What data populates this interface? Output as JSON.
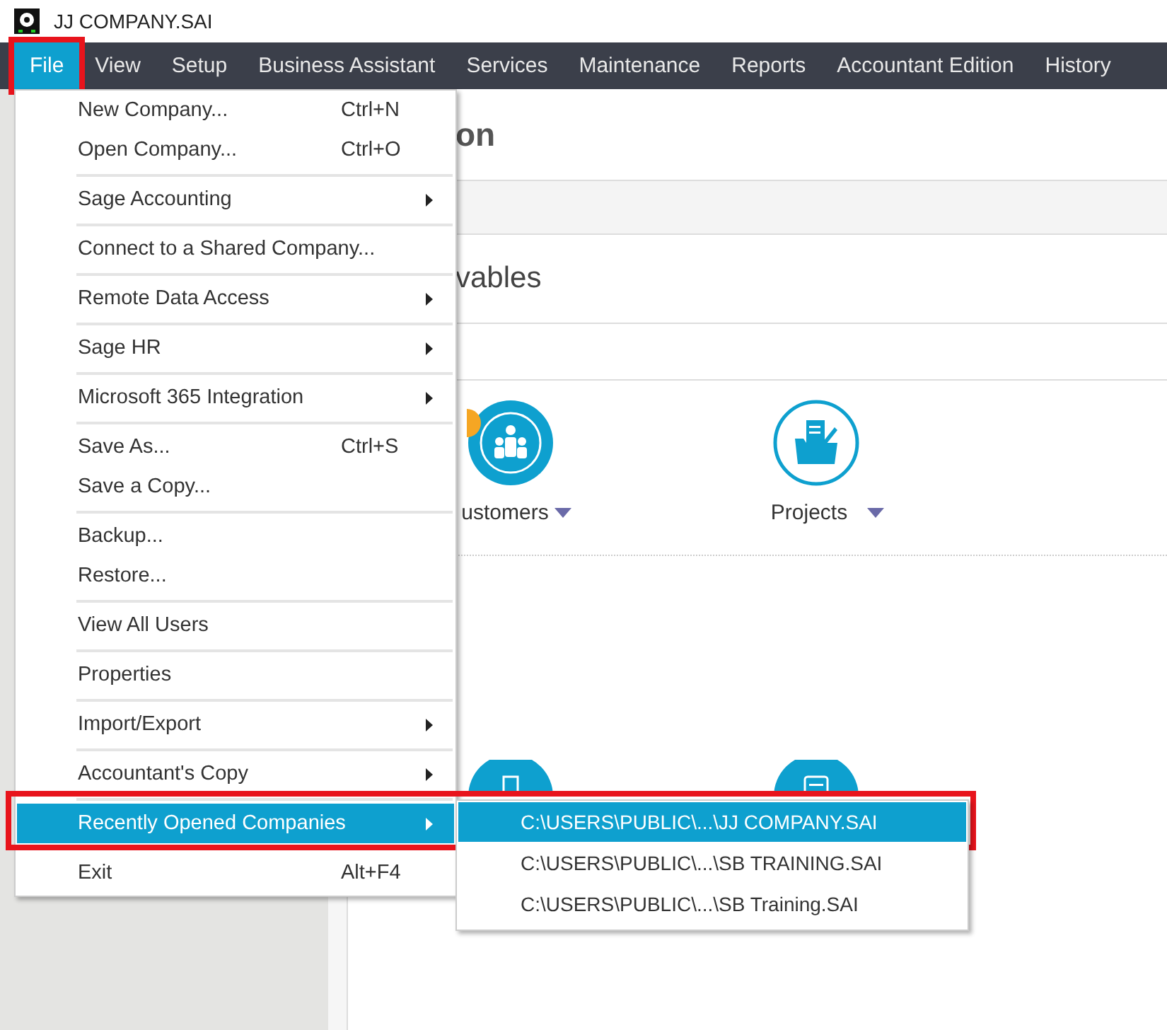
{
  "window": {
    "title": "JJ COMPANY.SAI"
  },
  "menubar": [
    {
      "label": "File",
      "selected": true,
      "highlighted": true
    },
    {
      "label": "View",
      "selected": false,
      "highlighted": false
    },
    {
      "label": "Setup",
      "selected": false,
      "highlighted": false
    },
    {
      "label": "Business Assistant",
      "selected": false,
      "highlighted": false
    },
    {
      "label": "Services",
      "selected": false,
      "highlighted": false
    },
    {
      "label": "Maintenance",
      "selected": false,
      "highlighted": false
    },
    {
      "label": "Reports",
      "selected": false,
      "highlighted": false
    },
    {
      "label": "Accountant Edition",
      "selected": false,
      "highlighted": false
    },
    {
      "label": "History",
      "selected": false,
      "highlighted": false
    }
  ],
  "file_menu": [
    [
      {
        "label": "New Company...",
        "shortcut": "Ctrl+N",
        "submenu": false,
        "selected": false
      },
      {
        "label": "Open Company...",
        "shortcut": "Ctrl+O",
        "submenu": false,
        "selected": false
      }
    ],
    [
      {
        "label": "Sage Accounting",
        "submenu": true,
        "selected": false
      }
    ],
    [
      {
        "label": "Connect to a Shared Company...",
        "submenu": false,
        "selected": false
      }
    ],
    [
      {
        "label": "Remote Data Access",
        "submenu": true,
        "selected": false
      }
    ],
    [
      {
        "label": "Sage HR",
        "submenu": true,
        "selected": false
      }
    ],
    [
      {
        "label": "Microsoft 365 Integration",
        "submenu": true,
        "selected": false
      }
    ],
    [
      {
        "label": "Save As...",
        "shortcut": "Ctrl+S",
        "submenu": false,
        "selected": false
      },
      {
        "label": "Save a Copy...",
        "submenu": false,
        "selected": false
      }
    ],
    [
      {
        "label": "Backup...",
        "submenu": false,
        "selected": false
      },
      {
        "label": "Restore...",
        "submenu": false,
        "selected": false
      }
    ],
    [
      {
        "label": "View All Users",
        "submenu": false,
        "selected": false
      }
    ],
    [
      {
        "label": "Properties",
        "submenu": false,
        "selected": false
      }
    ],
    [
      {
        "label": "Import/Export",
        "submenu": true,
        "selected": false
      }
    ],
    [
      {
        "label": "Accountant's Copy",
        "submenu": true,
        "selected": false
      }
    ],
    [
      {
        "label": "Recently Opened Companies",
        "submenu": true,
        "selected": true,
        "highlighted": true
      }
    ],
    [
      {
        "label": "Exit",
        "shortcut": "Alt+F4",
        "submenu": false,
        "selected": false
      }
    ]
  ],
  "recent_companies": [
    {
      "label": "C:\\USERS\\PUBLIC\\...\\JJ COMPANY.SAI",
      "selected": true
    },
    {
      "label": "C:\\USERS\\PUBLIC\\...\\SB TRAINING.SAI",
      "selected": false
    },
    {
      "label": "C:\\USERS\\PUBLIC\\...\\SB Training.SAI",
      "selected": false
    }
  ],
  "content": {
    "heading": "on",
    "section_title": "vables",
    "tiles": [
      {
        "label": "ustomers",
        "kind": "customers"
      },
      {
        "label": "Projects",
        "kind": "projects"
      }
    ]
  }
}
